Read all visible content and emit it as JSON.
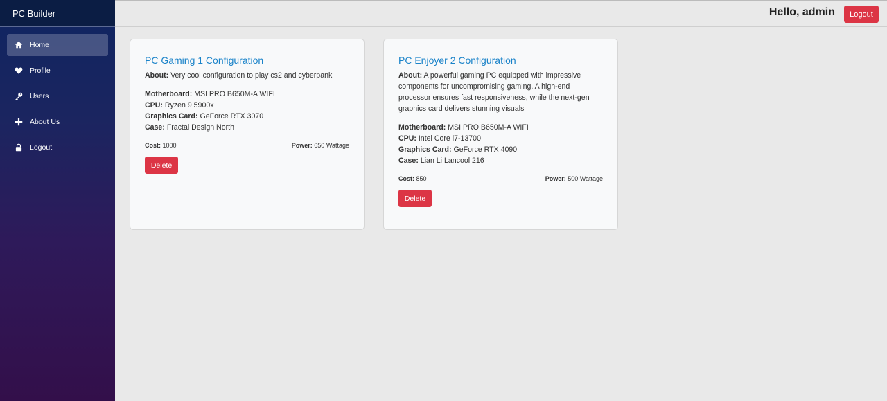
{
  "sidebar": {
    "brand": "PC Builder",
    "items": [
      {
        "label": "Home",
        "icon": "home-icon",
        "active": true
      },
      {
        "label": "Profile",
        "icon": "heart-icon"
      },
      {
        "label": "Users",
        "icon": "key-icon"
      },
      {
        "label": "About Us",
        "icon": "plus-icon"
      },
      {
        "label": "Logout",
        "icon": "lock-icon"
      }
    ]
  },
  "header": {
    "greeting": "Hello, admin",
    "logout_label": "Logout"
  },
  "labels": {
    "about": "About:",
    "motherboard": "Motherboard:",
    "cpu": "CPU:",
    "gpu": "Graphics Card:",
    "case": "Case:",
    "cost": "Cost:",
    "power": "Power:",
    "delete": "Delete"
  },
  "cards": [
    {
      "title": "PC Gaming 1 Configuration",
      "about": "Very cool configuration to play cs2 and cyberpank",
      "motherboard": "MSI PRO B650M-A WIFI",
      "cpu": "Ryzen 9 5900x",
      "gpu": "GeForce RTX 3070",
      "case": "Fractal Design North",
      "cost": "1000",
      "power": "650 Wattage"
    },
    {
      "title": "PC Enjoyer 2 Configuration",
      "about": "A powerful gaming PC equipped with impressive components for uncompromising gaming. A high-end processor ensures fast responsiveness, while the next-gen graphics card delivers stunning visuals",
      "motherboard": "MSI PRO B650M-A WIFI",
      "cpu": "Intel Core i7-13700",
      "gpu": "GeForce RTX 4090",
      "case": "Lian Li Lancool 216",
      "cost": "850",
      "power": "500 Wattage"
    }
  ],
  "colors": {
    "accent_red": "#dc3545",
    "title_blue": "#1a83c9",
    "sidebar_top": "#0f2561",
    "sidebar_bottom": "#330f4a"
  }
}
